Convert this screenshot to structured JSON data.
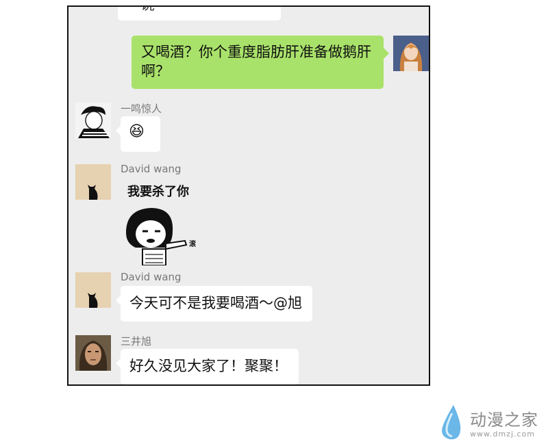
{
  "chat": {
    "top_partial_text": "一说",
    "sent_message": "又喝酒？你个重度脂肪肝准备做鹅肝啊？",
    "messages": [
      {
        "sender": "一鸣惊人",
        "content": "😆"
      },
      {
        "sender": "David wang",
        "sticker_caption": "我要杀了你",
        "sticker_aside": "滚"
      },
      {
        "sender": "David wang",
        "text": "今天可不是我要喝酒～@旭"
      },
      {
        "sender": "三井旭",
        "text": "好久没见大家了！聚聚！"
      }
    ]
  },
  "watermark": {
    "brand": "动漫之家",
    "url": "www.dmzj.com"
  }
}
